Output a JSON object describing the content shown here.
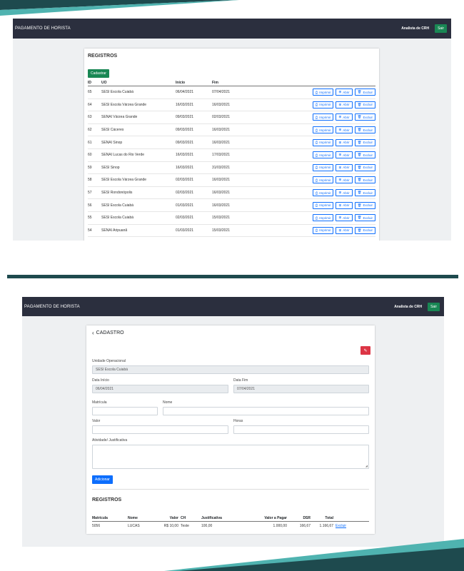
{
  "colors": {
    "navbar": "#2b2f3e",
    "success": "#198754",
    "primary": "#0d6efd",
    "danger": "#dc3545",
    "teal": "#1e4a4e"
  },
  "app": {
    "title": "PAGAMENTO DE HORISTA",
    "user": "Analista de CRH",
    "logout_label": "Sair"
  },
  "list": {
    "title": "REGISTROS",
    "add_label": "Cadastrar",
    "headers": {
      "id": "ID",
      "uo": "UO",
      "inicio": "Início",
      "fim": "Fim"
    },
    "actions": {
      "print": "Imprimir",
      "open": "Abrir",
      "delete": "Excluir"
    },
    "rows": [
      {
        "id": "65",
        "uo": "SESI Escola Cuiabá",
        "inicio": "06/04/2021",
        "fim": "07/04/2021"
      },
      {
        "id": "64",
        "uo": "SESI Escola Várzea Grande",
        "inicio": "16/03/2021",
        "fim": "16/03/2021"
      },
      {
        "id": "63",
        "uo": "SENAI Várzea Grande",
        "inicio": "09/03/2021",
        "fim": "02/03/2021"
      },
      {
        "id": "62",
        "uo": "SESI Cáceres",
        "inicio": "09/03/2021",
        "fim": "16/03/2021"
      },
      {
        "id": "61",
        "uo": "SENAI Sinop",
        "inicio": "09/03/2021",
        "fim": "16/03/2021"
      },
      {
        "id": "60",
        "uo": "SENAI Lucas do Rio Verde",
        "inicio": "16/03/2021",
        "fim": "17/03/2021"
      },
      {
        "id": "59",
        "uo": "SESI Sinop",
        "inicio": "16/03/2021",
        "fim": "31/03/2021"
      },
      {
        "id": "58",
        "uo": "SESI Escola Várzea Grande",
        "inicio": "02/03/2021",
        "fim": "16/03/2021"
      },
      {
        "id": "57",
        "uo": "SESI Rondonópolis",
        "inicio": "02/03/2021",
        "fim": "16/03/2021"
      },
      {
        "id": "56",
        "uo": "SESI Escola Cuiabá",
        "inicio": "01/03/2021",
        "fim": "16/03/2021"
      },
      {
        "id": "55",
        "uo": "SESI Escola Cuiabá",
        "inicio": "02/03/2021",
        "fim": "15/03/2021"
      },
      {
        "id": "54",
        "uo": "SENAI Aripuanã",
        "inicio": "01/03/2021",
        "fim": "15/03/2021"
      }
    ]
  },
  "form": {
    "title": "CADASTRO",
    "unidade_label": "Unidade Operacional",
    "unidade_value": "SESI Escola Cuiabá",
    "data_inicio_label": "Data Início",
    "data_inicio_value": "06/04/2021",
    "data_fim_label": "Data Fim",
    "data_fim_value": "07/04/2021",
    "matricula_label": "Matrícula",
    "nome_label": "Nome",
    "valor_label": "Valor",
    "horas_label": "Horas",
    "atividade_label": "Atividade/ Justificativa",
    "add_label": "Adicionar",
    "registros_title": "REGISTROS",
    "headers": {
      "matricula": "Matrícula",
      "nome": "Nome",
      "valor": "Valor",
      "ch": "CH",
      "justificativa": "Justificativa",
      "valor_pagar": "Valor a Pagar",
      "dsr": "DSR",
      "total": "Total"
    },
    "row": {
      "matricula": "5056",
      "nome": "LUCAS",
      "valor": "R$ 10,00",
      "ch": "Teste",
      "justificativa": "100,00",
      "valor_pagar": "1.000,00",
      "dsr": "166,67",
      "total": "1.166,67",
      "delete": "Excluir"
    }
  }
}
